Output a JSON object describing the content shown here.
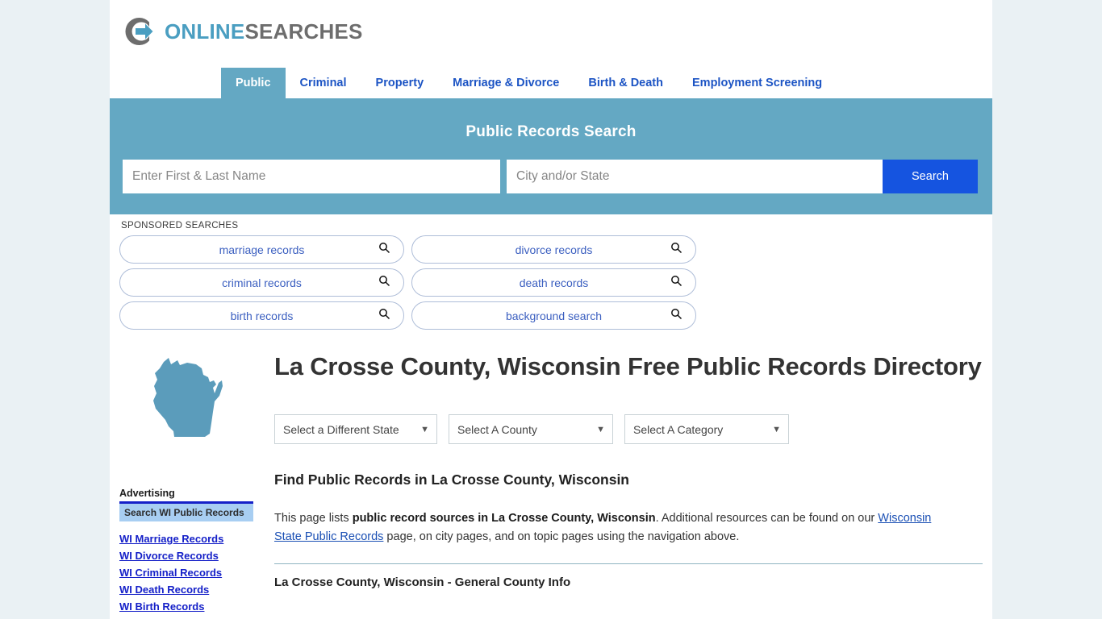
{
  "brand": {
    "name_part1": "ONLINE",
    "name_part2": "SEARCHES",
    "logo_icon": "circle-arrow-icon",
    "accent_blue": "#4a9ec1",
    "gray": "#6d6d6d"
  },
  "nav": {
    "tabs": [
      {
        "label": "Public",
        "active": true
      },
      {
        "label": "Criminal",
        "active": false
      },
      {
        "label": "Property",
        "active": false
      },
      {
        "label": "Marriage & Divorce",
        "active": false
      },
      {
        "label": "Birth & Death",
        "active": false
      },
      {
        "label": "Employment Screening",
        "active": false
      }
    ]
  },
  "banner": {
    "title": "Public Records Search",
    "background": "#64a8c3",
    "name_placeholder": "Enter First & Last Name",
    "name_value": "",
    "city_placeholder": "City and/or State",
    "city_value": "",
    "search_button": "Search",
    "search_button_color": "#1554e0"
  },
  "sponsored": {
    "label": "SPONSORED SEARCHES",
    "items": [
      {
        "label": "marriage records",
        "icon": "search-icon"
      },
      {
        "label": "divorce records",
        "icon": "search-icon"
      },
      {
        "label": "criminal records",
        "icon": "search-icon"
      },
      {
        "label": "death records",
        "icon": "search-icon"
      },
      {
        "label": "birth records",
        "icon": "search-icon"
      },
      {
        "label": "background search",
        "icon": "search-icon"
      }
    ]
  },
  "hero": {
    "map_icon": "wisconsin-state-map-icon",
    "map_color": "#5b9cbb",
    "title": "La Crosse County, Wisconsin Free Public Records Directory"
  },
  "filters": {
    "state": {
      "label": "Select a Different State",
      "caret": "chevron-down-icon"
    },
    "county": {
      "label": "Select A County",
      "caret": "chevron-down-icon"
    },
    "category": {
      "label": "Select A Category",
      "caret": "chevron-down-icon"
    }
  },
  "main": {
    "section_title": "Find Public Records in La Crosse County, Wisconsin",
    "paragraph_1": "This page lists ",
    "paragraph_bold": "public record sources in La Crosse County, Wisconsin",
    "paragraph_2": ". Additional resources can be found on our ",
    "paragraph_link": "Wisconsin State Public Records",
    "paragraph_3": " page, on city pages, and on topic pages using the navigation above.",
    "subsection_title": "La Crosse County, Wisconsin - General County Info"
  },
  "sidebar": {
    "advertising_label": "Advertising",
    "ad_box_title": "Search WI Public Records",
    "links": [
      {
        "label": "WI Marriage Records"
      },
      {
        "label": "WI Divorce Records"
      },
      {
        "label": "WI Criminal Records"
      },
      {
        "label": "WI Death Records"
      },
      {
        "label": "WI Birth Records"
      }
    ]
  }
}
